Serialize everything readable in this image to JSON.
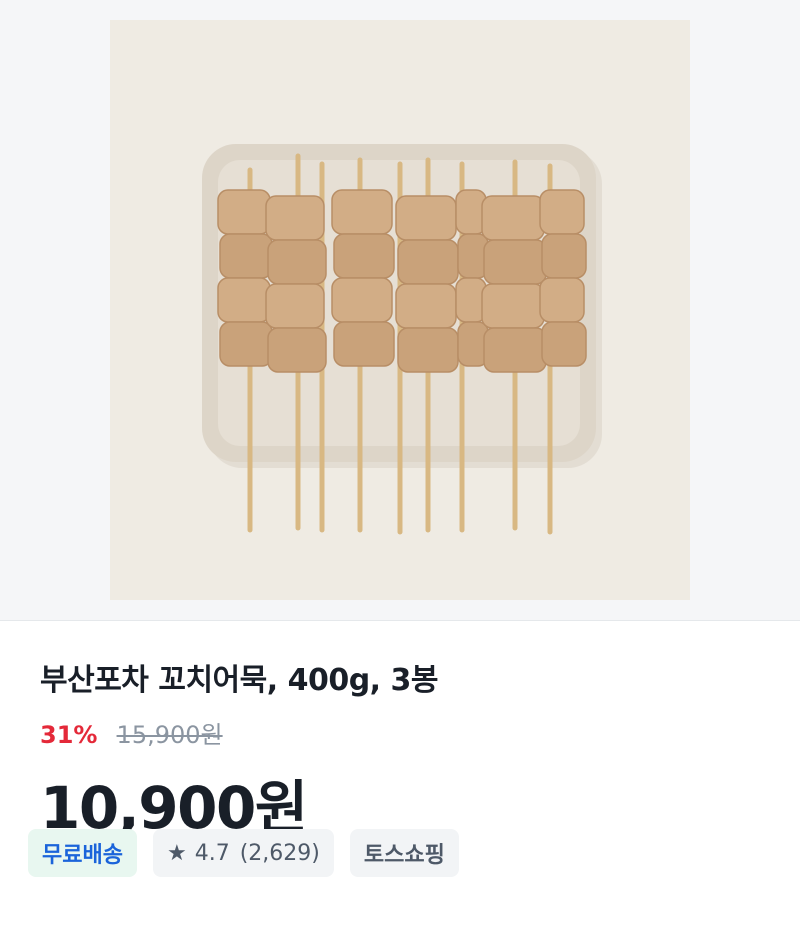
{
  "product": {
    "image_alt": "꼬치어묵 상품 이미지",
    "title": "부산포차 꼬치어묵, 400g, 3봉",
    "discount_rate": "31%",
    "original_price": "15,900원",
    "price": "10,900원"
  },
  "badges": {
    "free_shipping": "무료배송",
    "rating": "4.7",
    "review_count": "(2,629)",
    "store": "토스쇼핑",
    "star_icon": "★"
  },
  "colors": {
    "discount": "#e42939",
    "free_shipping_text": "#1b64da",
    "free_shipping_bg": "#e8f7f0",
    "chip_bg": "#f2f4f6"
  }
}
